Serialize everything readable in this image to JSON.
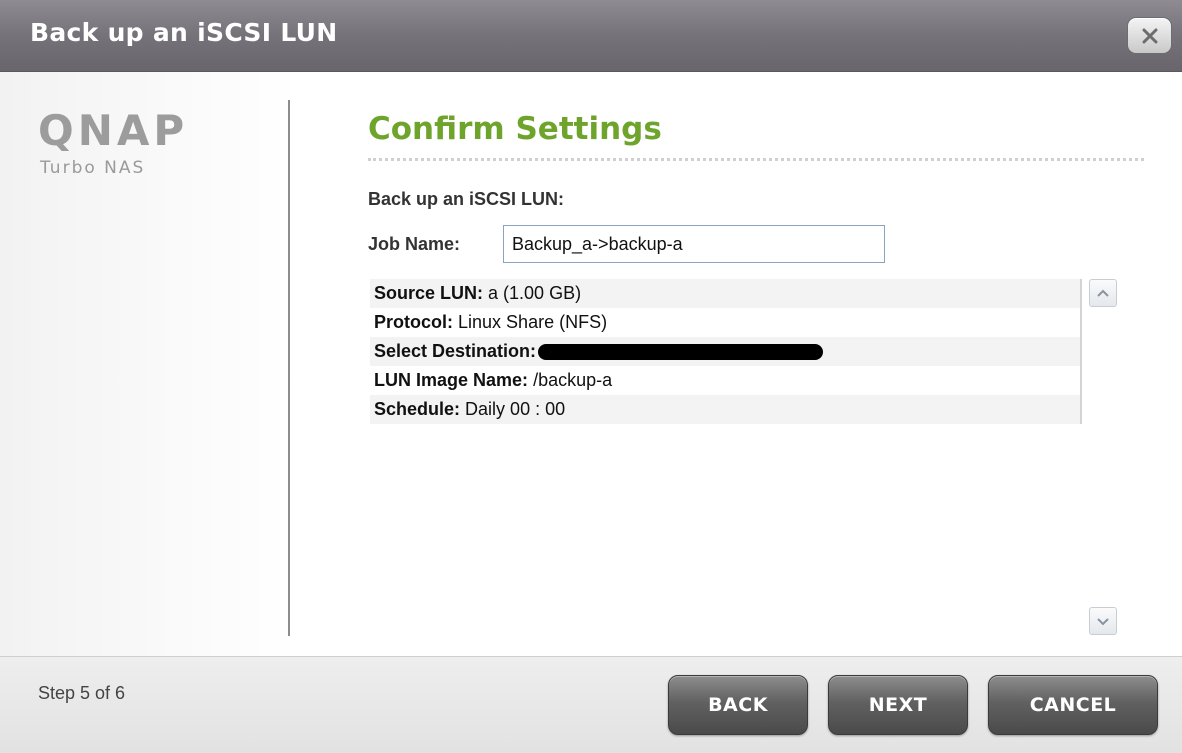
{
  "dialog": {
    "title": "Back up an iSCSI LUN",
    "close_icon": "close-icon"
  },
  "logo": {
    "brand": "QNAP",
    "product": "Turbo NAS"
  },
  "content": {
    "section_title": "Confirm Settings",
    "subheading": "Back up an iSCSI LUN:",
    "job_name_label": "Job Name:",
    "job_name_value": "Backup_a->backup-a",
    "summary": [
      {
        "label": "Source LUN:",
        "value": "a  (1.00 GB)"
      },
      {
        "label": "Protocol:",
        "value": "Linux Share (NFS)"
      },
      {
        "label": "Select Destination:",
        "value": ""
      },
      {
        "label": "LUN Image Name:",
        "value": "/backup-a"
      },
      {
        "label": "Schedule:",
        "value": "Daily 00 : 00"
      }
    ]
  },
  "footer": {
    "step": "Step 5 of 6",
    "back_label": "BACK",
    "next_label": "NEXT",
    "cancel_label": "CANCEL"
  },
  "colors": {
    "accent": "#6fa42c",
    "titlebar": "#757279"
  }
}
